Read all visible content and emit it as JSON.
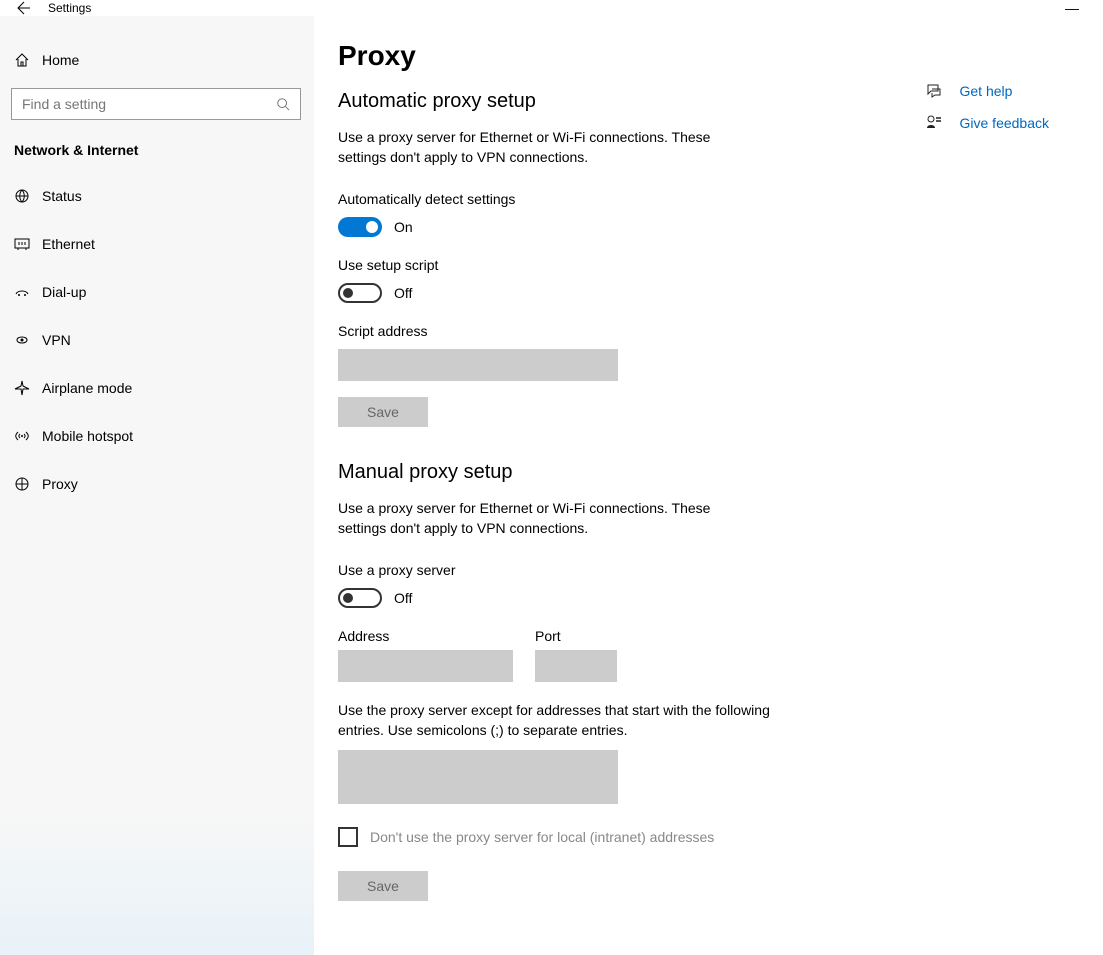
{
  "window": {
    "title": "Settings",
    "minimize": "—"
  },
  "sidebar": {
    "home": "Home",
    "search_placeholder": "Find a setting",
    "section": "Network & Internet",
    "items": [
      {
        "label": "Status"
      },
      {
        "label": "Ethernet"
      },
      {
        "label": "Dial-up"
      },
      {
        "label": "VPN"
      },
      {
        "label": "Airplane mode"
      },
      {
        "label": "Mobile hotspot"
      },
      {
        "label": "Proxy"
      }
    ]
  },
  "page": {
    "title": "Proxy",
    "auto": {
      "heading": "Automatic proxy setup",
      "desc": "Use a proxy server for Ethernet or Wi-Fi connections. These settings don't apply to VPN connections.",
      "detect_label": "Automatically detect settings",
      "detect_state": "On",
      "script_label": "Use setup script",
      "script_state": "Off",
      "addr_label": "Script address",
      "save": "Save"
    },
    "manual": {
      "heading": "Manual proxy setup",
      "desc": "Use a proxy server for Ethernet or Wi-Fi connections. These settings don't apply to VPN connections.",
      "use_label": "Use a proxy server",
      "use_state": "Off",
      "address_label": "Address",
      "port_label": "Port",
      "except_label": "Use the proxy server except for addresses that start with the following entries. Use semicolons (;) to separate entries.",
      "bypass_local": "Don't use the proxy server for local (intranet) addresses",
      "save": "Save"
    }
  },
  "help": {
    "get_help": "Get help",
    "feedback": "Give feedback"
  }
}
